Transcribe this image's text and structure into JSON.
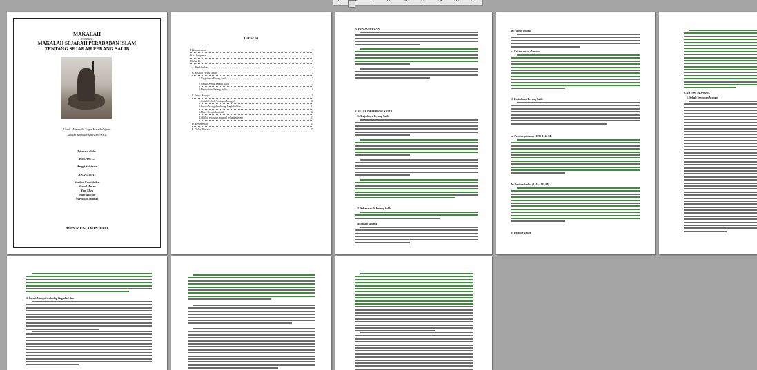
{
  "ruler": {
    "ticks": [
      "2",
      "4",
      "6",
      "8",
      "10",
      "12",
      "14",
      "16",
      "18"
    ]
  },
  "cover": {
    "title": "MAKALAH",
    "subtitle": "TENTANG",
    "title_line1": "MAKALAH SEJARAH PERADABAN ISLAM",
    "title_line2": "TENTANG SEJARAH PERANG SALIB",
    "image_alt": "crusader-knight-image",
    "purpose_line1": "Untuk Memenuhi Tugas Mata Pelajaran",
    "purpose_line2": "Sejarah Kebudayaan Islam (SKI)",
    "label_by": "Disusun oleh :",
    "label_group": "KELAS : ...",
    "leader": "Anggi Sriviana",
    "label_members": "ANGGOTA :",
    "members": [
      "Nurdian Fauziah Ayu",
      "Ahmad Hanan",
      "Yuni Eliza",
      "Budi Irawan",
      "Nurulsyah Jamilah"
    ],
    "school": "MTS MUSLIMIN JATI"
  },
  "toc": {
    "title": "Daftar Isi",
    "rows": [
      {
        "label": "Halaman Judul",
        "page": "1"
      },
      {
        "label": "Kata Pengantar",
        "page": "2"
      },
      {
        "label": "Daftar Isi",
        "page": "3"
      },
      {
        "label": "A.   Pendahuluan",
        "page": "4"
      },
      {
        "label": "B. Sejarah Perang Salib",
        "page": "5"
      },
      {
        "label": "1.  Terjadinya Perang Salib",
        "page": "5"
      },
      {
        "label": "2.  Sebab-Sebab Perang Salib",
        "page": "7"
      },
      {
        "label": "3.  Periodisasi Perang Salib",
        "page": "8"
      },
      {
        "label": "C. Invasi Mongol",
        "page": "9"
      },
      {
        "label": "1.  Sebab-Sebab Serangan Mongol",
        "page": "10"
      },
      {
        "label": "2.  Invasi Mongol terhadap Baghdad dan",
        "page": "11"
      },
      {
        "label": "3.  Bani Abbasiah runtuh",
        "page": "12"
      },
      {
        "label": "4.  Akibat serangan mongol terhadap islam",
        "page": "13"
      },
      {
        "label": "D.       Kesimpulan",
        "page": "14"
      },
      {
        "label": "E. Daftar Pustaka",
        "page": "15"
      }
    ]
  },
  "page3": {
    "heading1": "A.   PENDAHULUAN",
    "heading2": "B.   SEJARAH PERANG SALIB",
    "heading3": "1.   Terjadinya Perang Salib",
    "heading4": "2.   Sebab-sebab Perang Salib",
    "heading5": "a)   Faktor agama"
  },
  "page4": {
    "heading1": "b)   Faktor politik",
    "heading2": "c)   Faktor sosial ekonomi",
    "heading3": "3.   Periodisasi Perang Salib",
    "heading4": "a)   Periode pertama (1096-1144 M)",
    "heading5": "b)   Periode kedua (1144-1192 M)",
    "heading6": "c)   Periode ketiga"
  },
  "page5": {
    "heading1": "C.   INVASI MONGOL",
    "heading2": "1.   Sebab Serangan Mongol"
  },
  "page6": {
    "heading1": "2.   Invasi Mongol terhadap Baghdad dan"
  },
  "colors": {
    "green_text": "#3f8a3c",
    "body_text": "#6a6a6a",
    "background": "#a5a5a5"
  }
}
